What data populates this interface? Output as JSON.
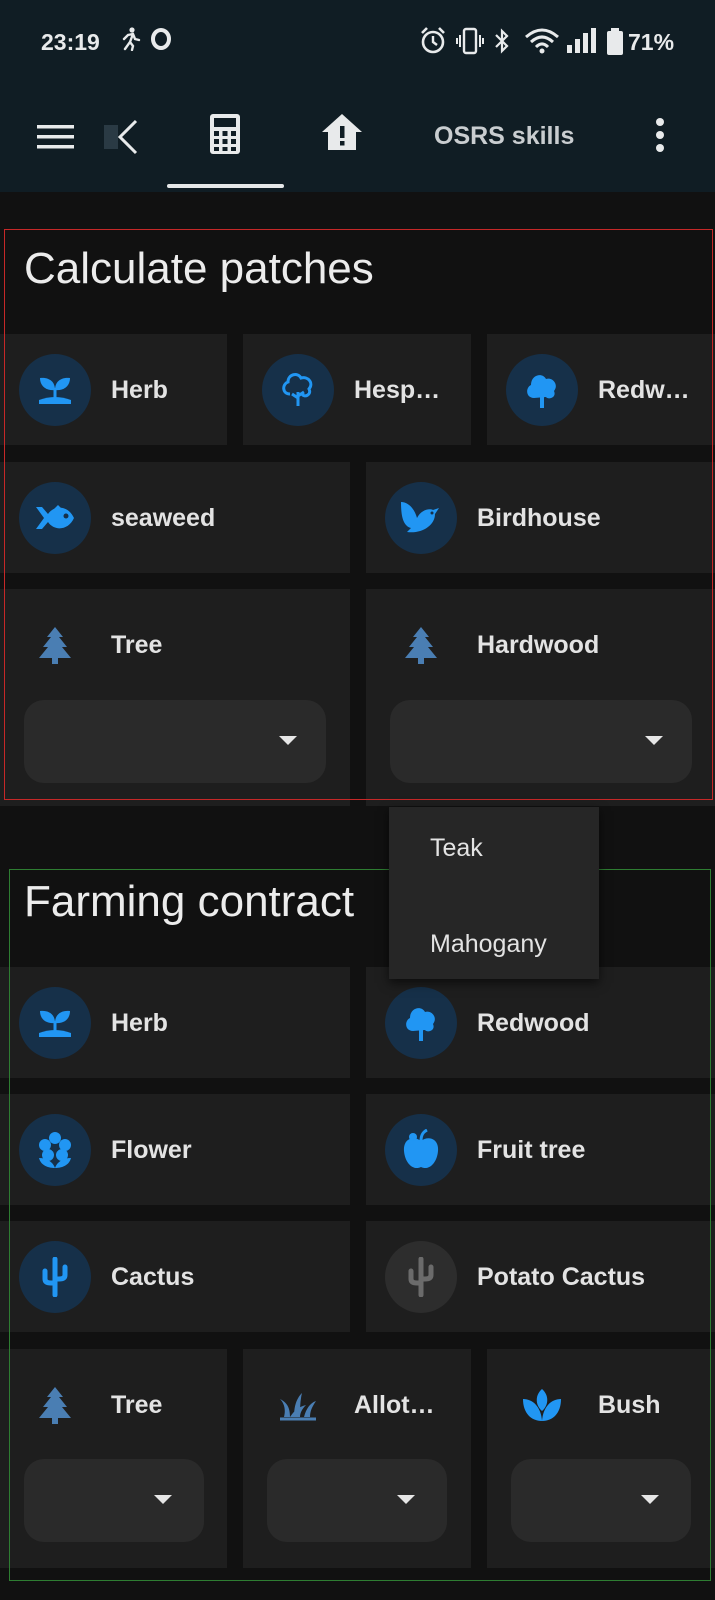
{
  "status_bar": {
    "time": "23:19",
    "battery": "71%",
    "icons": [
      "running-icon",
      "opera-icon",
      "alarm-icon",
      "vibrate-icon",
      "bluetooth-icon",
      "wifi-icon",
      "signal-icon",
      "battery-icon"
    ]
  },
  "app_bar": {
    "menu_icon": "menu-icon",
    "tabs": [
      {
        "icon": "back-arrow-icon"
      },
      {
        "icon": "calculator-icon",
        "selected": true
      },
      {
        "icon": "house-alert-icon"
      },
      {
        "label": "OSRS skills"
      }
    ],
    "overflow_icon": "more-vert-icon"
  },
  "calculate_patches": {
    "title": "Calculate patches",
    "row1": [
      {
        "label": "Herb",
        "icon": "sprout-icon"
      },
      {
        "label": "Hesp…",
        "icon": "tree-outline-icon"
      },
      {
        "label": "Redw…",
        "icon": "tree-filled-icon"
      }
    ],
    "row2": [
      {
        "label": "seaweed",
        "icon": "fish-icon"
      },
      {
        "label": "Birdhouse",
        "icon": "bird-icon"
      }
    ],
    "row3": [
      {
        "label": "Tree",
        "icon": "pine-tree-icon",
        "selected_value": ""
      },
      {
        "label": "Hardwood",
        "icon": "pine-tree-icon",
        "selected_value": ""
      }
    ]
  },
  "dropdown_menu": {
    "options": [
      "Teak",
      "Mahogany"
    ]
  },
  "farming_contract": {
    "title": "Farming contract",
    "rows": [
      [
        {
          "label": "Herb",
          "icon": "sprout-icon"
        },
        {
          "label": "Redwood",
          "icon": "tree-filled-icon"
        }
      ],
      [
        {
          "label": "Flower",
          "icon": "flower-icon"
        },
        {
          "label": "Fruit tree",
          "icon": "apple-icon"
        }
      ],
      [
        {
          "label": "Cactus",
          "icon": "cactus-icon"
        },
        {
          "label": "Potato Cactus",
          "icon": "cactus-icon"
        }
      ]
    ],
    "bottom_row": [
      {
        "label": "Tree",
        "icon": "pine-tree-icon",
        "selected_value": ""
      },
      {
        "label": "Allot…",
        "icon": "grass-icon",
        "selected_value": ""
      },
      {
        "label": "Bush",
        "icon": "spa-icon",
        "selected_value": ""
      }
    ]
  },
  "colors": {
    "accent_blue": "#2196f3",
    "avatar_bg": "#163049",
    "card_bg": "#1e1e1e",
    "outline_red": "#c62828",
    "outline_green": "#2e7d32"
  }
}
